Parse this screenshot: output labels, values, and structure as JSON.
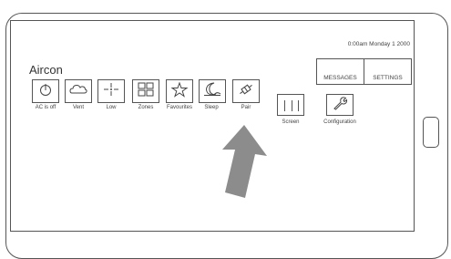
{
  "status": {
    "clock": "0:00am Monday 1  2000"
  },
  "page": {
    "title": "Aircon"
  },
  "tiles": [
    {
      "label": "AC is off",
      "icon": "power-icon"
    },
    {
      "label": "Vent",
      "icon": "cloud-icon"
    },
    {
      "label": "Low",
      "icon": "fan-speed-icon"
    },
    {
      "label": "Zones",
      "icon": "grid-icon"
    },
    {
      "label": "Favourites",
      "icon": "star-icon"
    },
    {
      "label": "Sleep",
      "icon": "moon-icon"
    },
    {
      "label": "Pair",
      "icon": "satellite-icon"
    }
  ],
  "tools": {
    "screen": {
      "label": "Screen",
      "icon": "screen-icon"
    },
    "configuration": {
      "label": "Configuration",
      "icon": "wrench-icon"
    }
  },
  "header_buttons": {
    "messages": "MESSAGES",
    "settings": "SETTINGS"
  },
  "colors": {
    "outline": "#555555",
    "arrow": "#8c8c8c",
    "background": "#ffffff"
  }
}
